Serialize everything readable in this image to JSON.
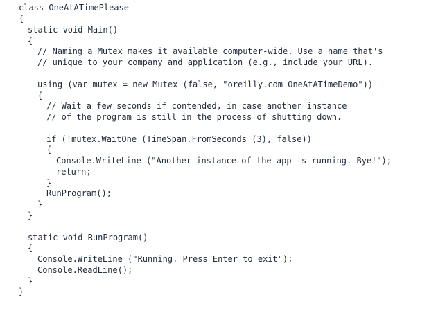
{
  "code_lines": [
    "class OneAtATimePlease",
    "{",
    "static void Main()",
    "{",
    "// Naming a Mutex makes it available computer-wide. Use a name that's",
    "// unique to your company and application (e.g., include your URL).",
    "using (var mutex = new Mutex (false, \"oreilly.com OneAtATimeDemo\"))",
    "{",
    "// Wait a few seconds if contended, in case another instance",
    "// of the program is still in the process of shutting down.",
    "if (!mutex.WaitOne (TimeSpan.FromSeconds (3), false))",
    "{",
    "Console.WriteLine (\"Another instance of the app is running. Bye!\");",
    "return;",
    "}",
    "RunProgram();",
    "}",
    "}",
    "static void RunProgram()",
    "{",
    "Console.WriteLine (\"Running. Press Enter to exit\");",
    "Console.ReadLine();",
    "}",
    "}"
  ]
}
